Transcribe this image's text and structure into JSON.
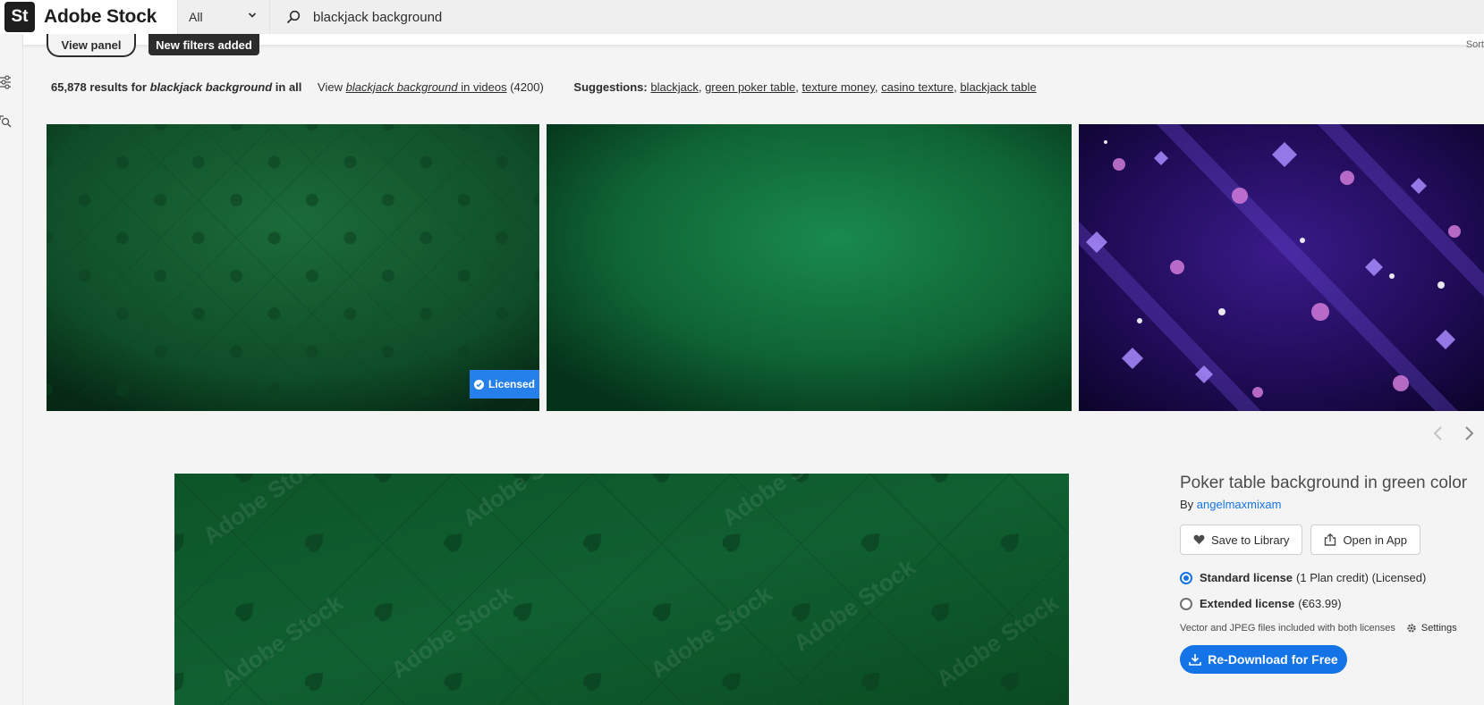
{
  "header": {
    "logo_badge": "St",
    "logo_text": "Adobe Stock",
    "scope_value": "All",
    "search_query": "blackjack background"
  },
  "toolbar": {
    "view_panel_label": "View panel",
    "new_filters_label": "New filters added",
    "sort_label": "Sort"
  },
  "results": {
    "count": "65,878",
    "results_for": "results for",
    "query": "blackjack background",
    "in_all": "in all",
    "view_label": "View",
    "view_query": "blackjack background",
    "in_videos": "in videos",
    "video_count": "(4200)",
    "suggestions_label": "Suggestions:",
    "suggestions": [
      "blackjack",
      "green poker table",
      "texture money",
      "casino texture",
      "blackjack table"
    ]
  },
  "tiles": [
    {
      "name": "green pattern poker background",
      "badge": "Licensed"
    },
    {
      "name": "green felt background"
    },
    {
      "name": "purple card suits background"
    }
  ],
  "detail": {
    "title": "Poker table background in green color",
    "by_label": "By",
    "author": "angelmaxmixam",
    "save_label": "Save to Library",
    "open_label": "Open in App",
    "standard_label": "Standard license",
    "standard_detail": "(1 Plan credit) (Licensed)",
    "extended_label": "Extended license",
    "extended_detail": "(€63.99)",
    "note": "Vector and JPEG files included with both licenses",
    "settings_label": "Settings",
    "redownload_label": "Re-Download for Free",
    "watermark": "Adobe Stock"
  },
  "colors": {
    "accent": "#1473e6",
    "licensed_badge": "#2680eb",
    "felt_green": "#0e5a2c"
  }
}
